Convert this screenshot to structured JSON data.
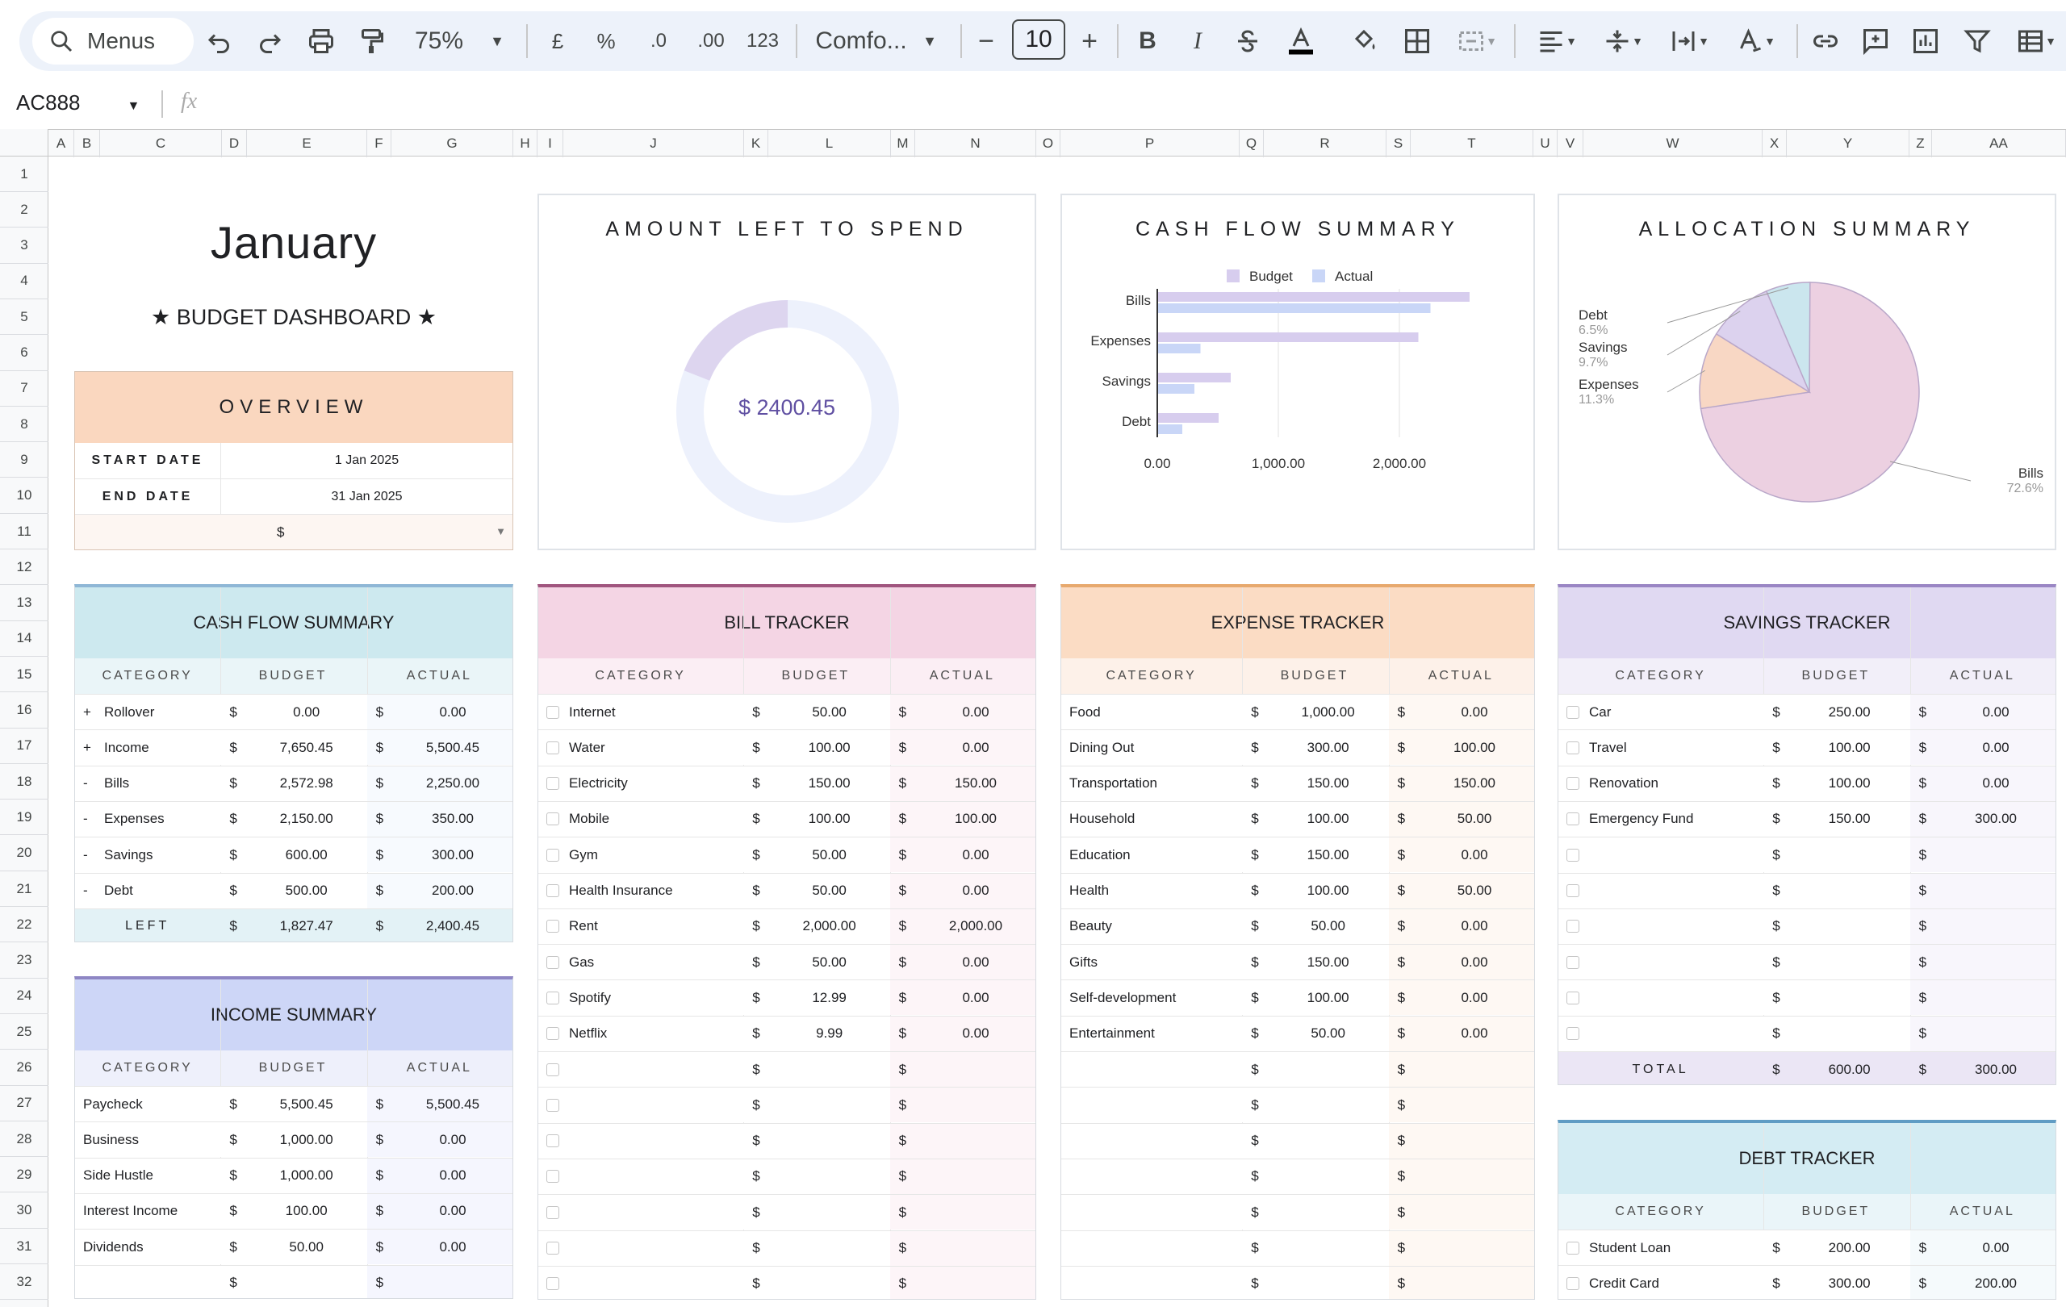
{
  "toolbar": {
    "menus": "Menus",
    "zoom": "75%",
    "currency": "£",
    "percent": "%",
    "dec_less": ".0",
    "dec_more": ".00",
    "format_num": "123",
    "font": "Comfo...",
    "font_size": "10",
    "bold": "B",
    "italic": "I"
  },
  "formula": {
    "cell": "AC888",
    "fx": "fx"
  },
  "columns": [
    "A",
    "B",
    "C",
    "D",
    "E",
    "F",
    "G",
    "H",
    "I",
    "J",
    "K",
    "L",
    "M",
    "N",
    "O",
    "P",
    "Q",
    "R",
    "S",
    "T",
    "U",
    "V",
    "W",
    "X",
    "Y",
    "Z",
    "AA"
  ],
  "rows": [
    "1",
    "2",
    "3",
    "4",
    "5",
    "6",
    "7",
    "8",
    "9",
    "10",
    "11",
    "12",
    "13",
    "14",
    "15",
    "16",
    "17",
    "18",
    "19",
    "20",
    "21",
    "22",
    "23",
    "24",
    "25",
    "26",
    "27",
    "28",
    "29",
    "30",
    "31",
    "32"
  ],
  "title": {
    "month": "January",
    "subtitle": "★ BUDGET DASHBOARD ★"
  },
  "overview": {
    "title": "OVERVIEW",
    "start_label": "START DATE",
    "start_value": "1 Jan 2025",
    "end_label": "END DATE",
    "end_value": "31 Jan 2025",
    "currency": "$"
  },
  "amount_left": {
    "title": "AMOUNT LEFT TO SPEND",
    "value": "$ 2400.45",
    "fraction": 0.19
  },
  "cashflow_chart_title": "CASH FLOW SUMMARY",
  "allocation_title": "ALLOCATION SUMMARY",
  "chart_data": [
    {
      "type": "bar",
      "orientation": "horizontal",
      "title": "CASH FLOW SUMMARY",
      "categories": [
        "Bills",
        "Expenses",
        "Savings",
        "Debt"
      ],
      "series": [
        {
          "name": "Budget",
          "values": [
            2572.98,
            2150,
            600,
            500
          ],
          "color": "#d7cdee"
        },
        {
          "name": "Actual",
          "values": [
            2250,
            350,
            300,
            200
          ],
          "color": "#c9d6f7"
        }
      ],
      "xlim": [
        0,
        3000
      ],
      "xticks": [
        "0.00",
        "1,000.00",
        "2,000.00"
      ],
      "legend": "top"
    },
    {
      "type": "pie",
      "title": "ALLOCATION SUMMARY",
      "slices": [
        {
          "label": "Bills",
          "pct": "72.6%",
          "value": 72.6,
          "color": "#ecd0e1"
        },
        {
          "label": "Expenses",
          "pct": "11.3%",
          "value": 11.3,
          "color": "#f8d7c4"
        },
        {
          "label": "Savings",
          "pct": "9.7%",
          "value": 9.7,
          "color": "#dcd2ee"
        },
        {
          "label": "Debt",
          "pct": "6.5%",
          "value": 6.5,
          "color": "#cbe6ee"
        }
      ]
    }
  ],
  "colheads": {
    "category": "CATEGORY",
    "budget": "BUDGET",
    "actual": "ACTUAL"
  },
  "cashflow": {
    "title": "CASH FLOW SUMMARY",
    "rows": [
      [
        "+",
        "Rollover",
        "0.00",
        "0.00"
      ],
      [
        "+",
        "Income",
        "7,650.45",
        "5,500.45"
      ],
      [
        "-",
        "Bills",
        "2,572.98",
        "2,250.00"
      ],
      [
        "-",
        "Expenses",
        "2,150.00",
        "350.00"
      ],
      [
        "-",
        "Savings",
        "600.00",
        "300.00"
      ],
      [
        "-",
        "Debt",
        "500.00",
        "200.00"
      ]
    ],
    "left_label": "LEFT",
    "left_budget": "1,827.47",
    "left_actual": "2,400.45"
  },
  "income": {
    "title": "INCOME SUMMARY",
    "rows": [
      [
        "Paycheck",
        "5,500.45",
        "5,500.45"
      ],
      [
        "Business",
        "1,000.00",
        "0.00"
      ],
      [
        "Side Hustle",
        "1,000.00",
        "0.00"
      ],
      [
        "Interest Income",
        "100.00",
        "0.00"
      ],
      [
        "Dividends",
        "50.00",
        "0.00"
      ],
      [
        "",
        "",
        ""
      ]
    ]
  },
  "bills": {
    "title": "BILL TRACKER",
    "rows": [
      [
        "Internet",
        "50.00",
        "0.00"
      ],
      [
        "Water",
        "100.00",
        "0.00"
      ],
      [
        "Electricity",
        "150.00",
        "150.00"
      ],
      [
        "Mobile",
        "100.00",
        "100.00"
      ],
      [
        "Gym",
        "50.00",
        "0.00"
      ],
      [
        "Health Insurance",
        "50.00",
        "0.00"
      ],
      [
        "Rent",
        "2,000.00",
        "2,000.00"
      ],
      [
        "Gas",
        "50.00",
        "0.00"
      ],
      [
        "Spotify",
        "12.99",
        "0.00"
      ],
      [
        "Netflix",
        "9.99",
        "0.00"
      ],
      [
        "",
        "",
        ""
      ],
      [
        "",
        "",
        ""
      ],
      [
        "",
        "",
        ""
      ],
      [
        "",
        "",
        ""
      ],
      [
        "",
        "",
        ""
      ],
      [
        "",
        "",
        ""
      ],
      [
        "",
        "",
        ""
      ]
    ]
  },
  "expenses": {
    "title": "EXPENSE TRACKER",
    "rows": [
      [
        "Food",
        "1,000.00",
        "0.00"
      ],
      [
        "Dining Out",
        "300.00",
        "100.00"
      ],
      [
        "Transportation",
        "150.00",
        "150.00"
      ],
      [
        "Household",
        "100.00",
        "50.00"
      ],
      [
        "Education",
        "150.00",
        "0.00"
      ],
      [
        "Health",
        "100.00",
        "50.00"
      ],
      [
        "Beauty",
        "50.00",
        "0.00"
      ],
      [
        "Gifts",
        "150.00",
        "0.00"
      ],
      [
        "Self-development",
        "100.00",
        "0.00"
      ],
      [
        "Entertainment",
        "50.00",
        "0.00"
      ],
      [
        "",
        "",
        ""
      ],
      [
        "",
        "",
        ""
      ],
      [
        "",
        "",
        ""
      ],
      [
        "",
        "",
        ""
      ],
      [
        "",
        "",
        ""
      ],
      [
        "",
        "",
        ""
      ],
      [
        "",
        "",
        ""
      ]
    ]
  },
  "savings": {
    "title": "SAVINGS TRACKER",
    "rows": [
      [
        "Car",
        "250.00",
        "0.00"
      ],
      [
        "Travel",
        "100.00",
        "0.00"
      ],
      [
        "Renovation",
        "100.00",
        "0.00"
      ],
      [
        "Emergency Fund",
        "150.00",
        "300.00"
      ],
      [
        "",
        "",
        ""
      ],
      [
        "",
        "",
        ""
      ],
      [
        "",
        "",
        ""
      ],
      [
        "",
        "",
        ""
      ],
      [
        "",
        "",
        ""
      ],
      [
        "",
        "",
        ""
      ]
    ],
    "total_label": "TOTAL",
    "total_budget": "600.00",
    "total_actual": "300.00"
  },
  "debt": {
    "title": "DEBT TRACKER",
    "rows": [
      [
        "Student Loan",
        "200.00",
        "0.00"
      ],
      [
        "Credit Card",
        "300.00",
        "200.00"
      ]
    ]
  },
  "colors": {
    "overview": "#fad7bf",
    "cashflow": "#cde9ef",
    "income": "#cdd6f7",
    "bills": "#f4d5e4",
    "expenses": "#fbdcc4",
    "savings": "#e0d9f2",
    "debt": "#d4ecf3"
  }
}
